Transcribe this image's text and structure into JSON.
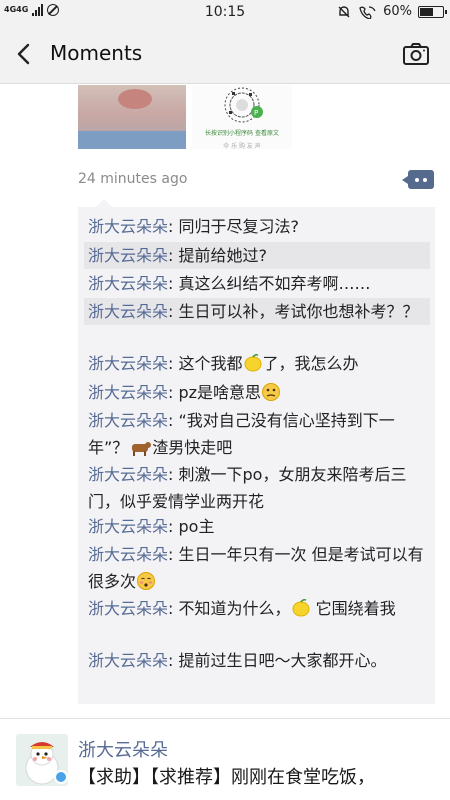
{
  "status_bar": {
    "network": "4G4G",
    "time": "10:15",
    "battery": "60%",
    "battery_level": 0.6
  },
  "nav": {
    "back_icon": "back-chevron-icon",
    "title": "Moments",
    "camera_icon": "camera-icon"
  },
  "post": {
    "time_ago": "24 minutes ago",
    "qr_caption": "长按识别小程序码 查看原文",
    "qr_caption2": "伞 乐 购 友 声",
    "more_icon": "more-dots-icon"
  },
  "comments": [
    {
      "name": "浙大云朵朵",
      "text": "同归于尽复习法?"
    },
    {
      "name": "浙大云朵朵",
      "text": "提前给她过?"
    },
    {
      "name": "浙大云朵朵",
      "text": "真这么纠结不如弃考啊……"
    },
    {
      "name": "浙大云朵朵",
      "text": "生日可以补，考试你也想补考？？"
    },
    {
      "name": "浙大云朵朵",
      "text_before": "这个我都",
      "emoji": "lemon-emoji",
      "text_after": "了，我怎么办"
    },
    {
      "name": "浙大云朵朵",
      "text_before": "pz是啥意思",
      "emoji": "thinking-emoji",
      "text_after": ""
    },
    {
      "name": "浙大云朵朵",
      "text_before": "“我对自己没有信心坚持到下一年”？",
      "emoji": "bull-emoji",
      "text_after": "渣男快走吧"
    },
    {
      "name": "浙大云朵朵",
      "text": "刺激一下po，女朋友来陪考后三门，似乎爱情学业两开花"
    },
    {
      "name": "浙大云朵朵",
      "text": "po主"
    },
    {
      "name": "浙大云朵朵",
      "text_before": "生日一年只有一次 但是考试可以有很多次",
      "emoji": "blush-emoji",
      "text_after": ""
    },
    {
      "name": "浙大云朵朵",
      "text_before": "不知道为什么，",
      "emoji": "lemon-emoji",
      "text_after": " 它围绕着我"
    },
    {
      "name": "浙大云朵朵",
      "text": "提前过生日吧～大家都开心。"
    }
  ],
  "next_post": {
    "name": "浙大云朵朵",
    "text": "【求助】【求推荐】刚刚在食堂吃饭，",
    "avatar": "snowman-avatar",
    "badge_icon": "verified-badge-icon"
  }
}
